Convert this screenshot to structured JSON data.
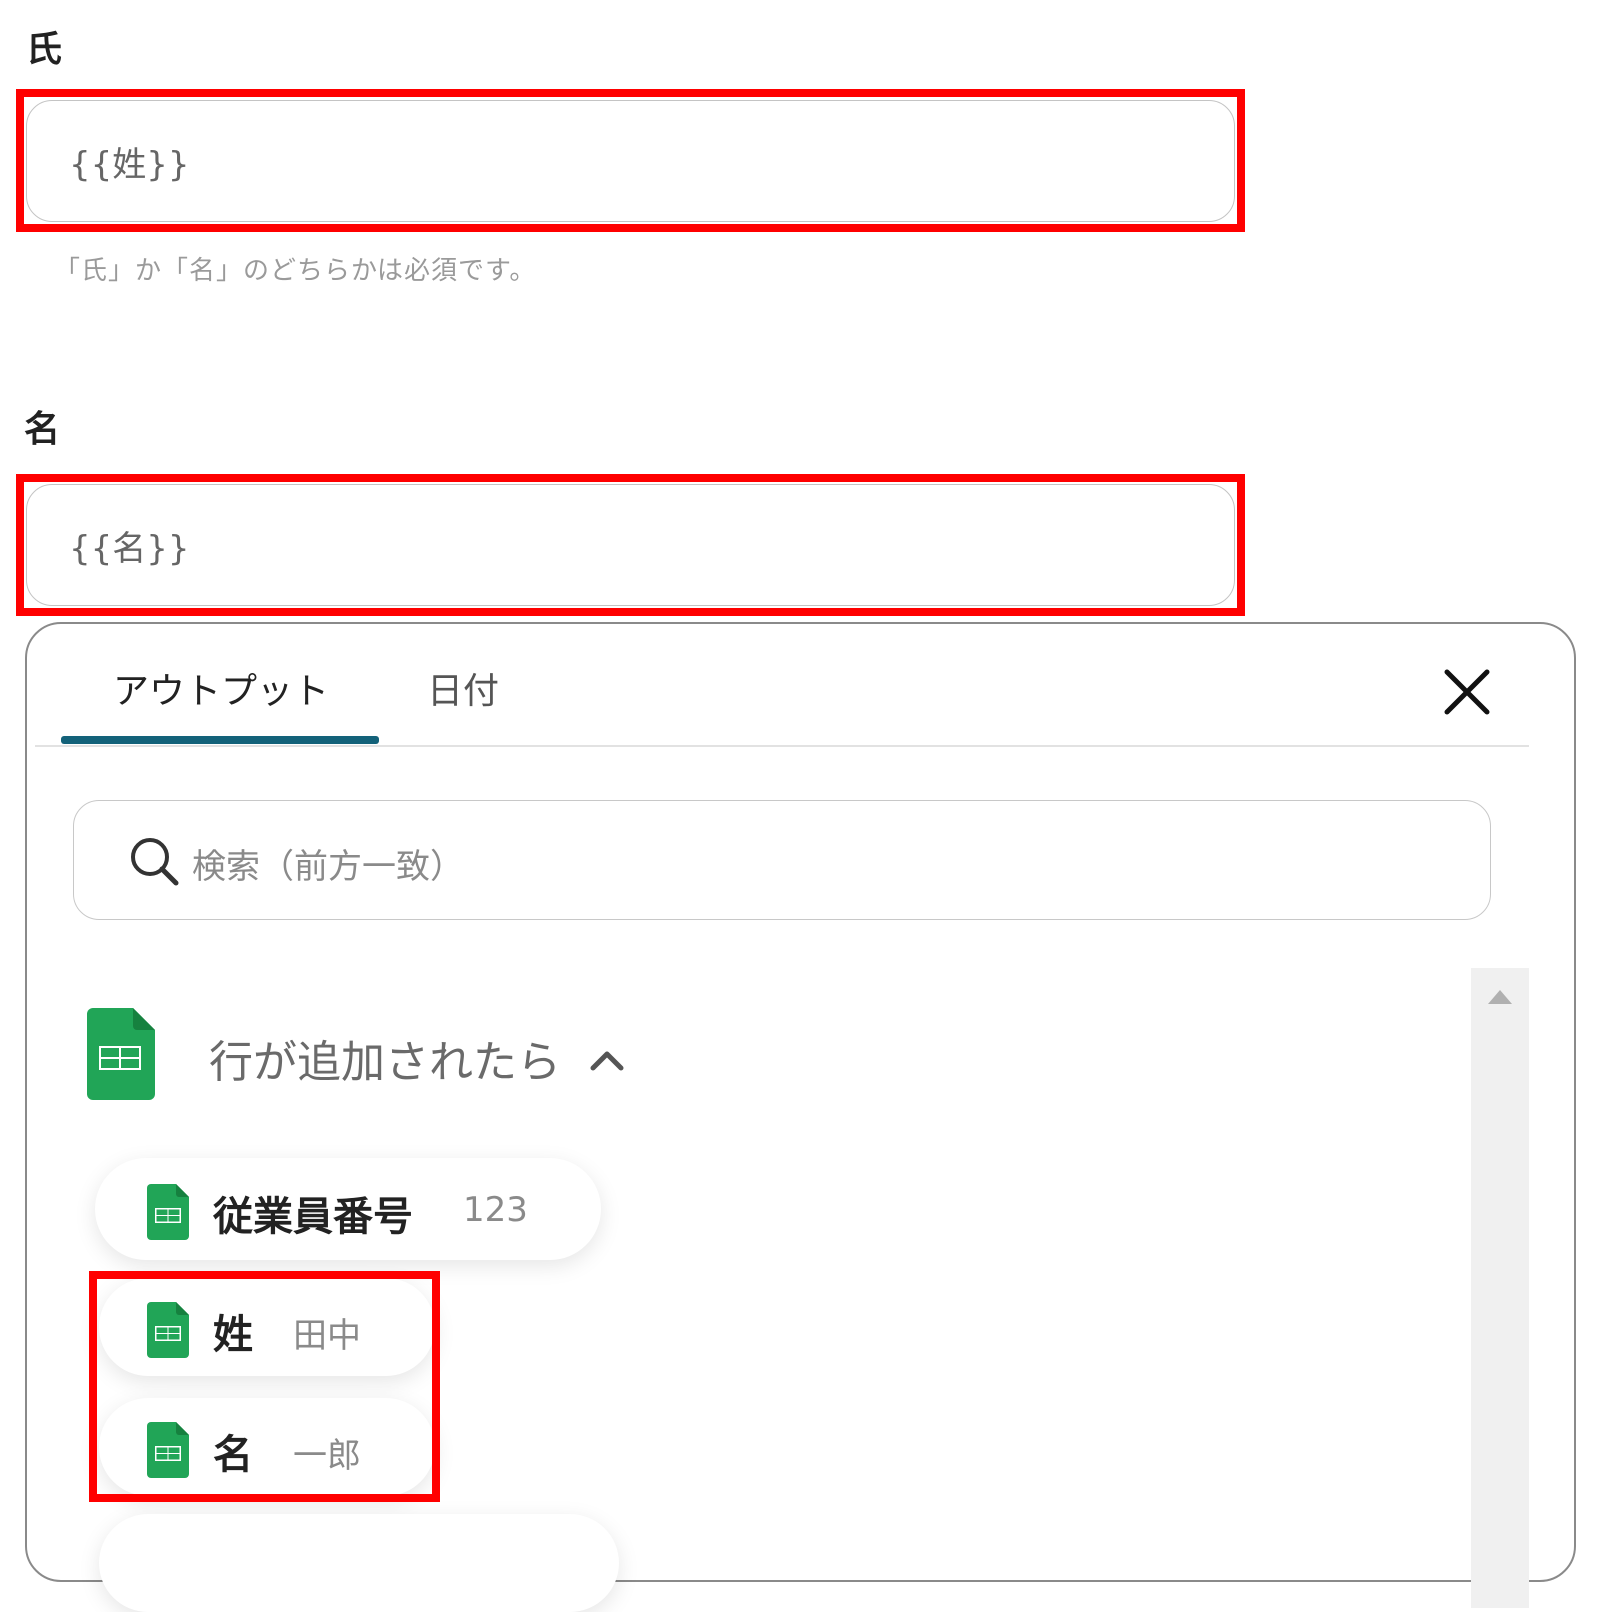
{
  "fields": {
    "last_name": {
      "label": "氏",
      "value": "{{姓}}"
    },
    "help": "「氏」か「名」のどちらかは必須です。",
    "first_name": {
      "label": "名",
      "value": "{{名}}"
    }
  },
  "panel": {
    "tabs": [
      {
        "label": "アウトプット",
        "active": true
      },
      {
        "label": "日付",
        "active": false
      }
    ],
    "search_placeholder": "検索（前方一致）",
    "group": {
      "title": "行が追加されたら",
      "icon": "google-sheets-icon",
      "items": [
        {
          "label": "従業員番号",
          "value": "123"
        },
        {
          "label": "姓",
          "value": "田中"
        },
        {
          "label": "名",
          "value": "一郎"
        }
      ]
    }
  },
  "colors": {
    "highlight": "#ff0000",
    "tab_accent": "#13627a",
    "sheets_green": "#21a557"
  }
}
